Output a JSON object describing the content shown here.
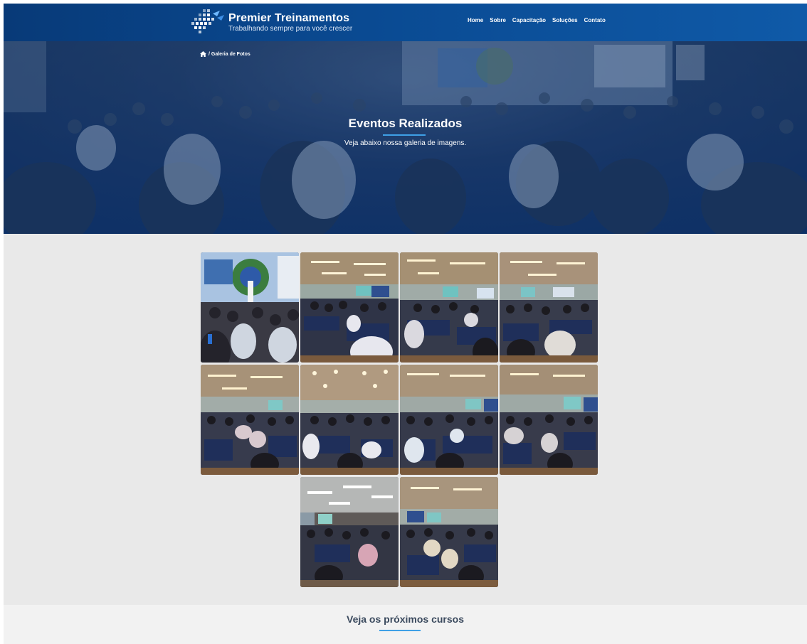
{
  "brand": {
    "title": "Premier Treinamentos",
    "tagline": "Trabalhando sempre para você crescer"
  },
  "nav": {
    "items": [
      "Home",
      "Sobre",
      "Capacitação",
      "Soluções",
      "Contato"
    ]
  },
  "breadcrumb": {
    "label": "/ Galeria de Fotos"
  },
  "hero": {
    "title": "Eventos Realizados",
    "subtitle": "Veja abaixo nossa galeria de imagens."
  },
  "gallery": {
    "photo_count": 10
  },
  "next_section": {
    "title": "Veja os próximos cursos"
  },
  "colors": {
    "header_blue": "#0a4a92",
    "accent_line": "#3fa0e6"
  },
  "icons": {
    "breadcrumb": "home-icon",
    "logo": "logo-mark-icon"
  }
}
